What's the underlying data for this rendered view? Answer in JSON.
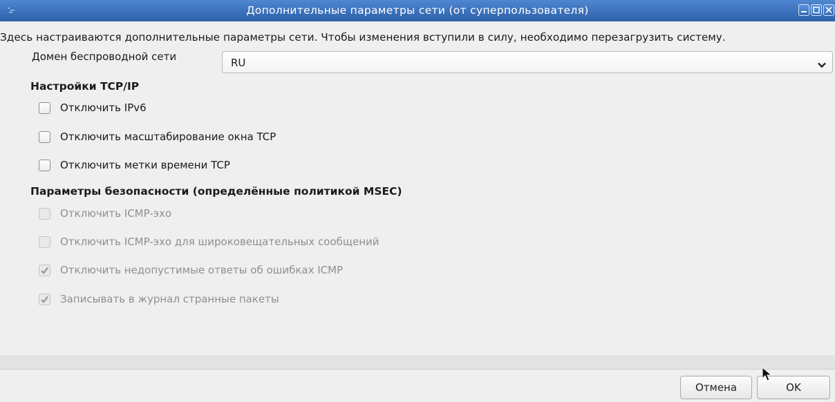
{
  "window": {
    "title": "Дополнительные параметры сети (от суперпользователя)",
    "icons": [
      "app-icon",
      "minimize-icon",
      "maximize-icon",
      "close-icon"
    ],
    "accent_color": "#3a6fb9"
  },
  "description": "Здесь настраиваются дополнительные параметры сети. Чтобы изменения вступили в силу, необходимо перезагрузить систему.",
  "wireless_domain": {
    "label": "Домен беспроводной сети",
    "value": "RU"
  },
  "tcp_ip": {
    "title": "Настройки TCP/IP",
    "options": [
      {
        "label": "Отключить IPv6",
        "checked": false,
        "enabled": true
      },
      {
        "label": "Отключить масштабирование окна TCP",
        "checked": false,
        "enabled": true
      },
      {
        "label": "Отключить метки времени TCP",
        "checked": false,
        "enabled": true
      }
    ]
  },
  "security": {
    "title": "Параметры безопасности (определённые политикой MSEC)",
    "options": [
      {
        "label": "Отключить ICMP-эхо",
        "checked": false,
        "enabled": false
      },
      {
        "label": "Отключить ICMP-эхо для широковещательных сообщений",
        "checked": false,
        "enabled": false
      },
      {
        "label": "Отключить недопустимые ответы об ошибках ICMP",
        "checked": true,
        "enabled": false
      },
      {
        "label": "Записывать в журнал странные пакеты",
        "checked": true,
        "enabled": false
      }
    ]
  },
  "buttons": {
    "cancel": "Отмена",
    "ok": "OK"
  }
}
